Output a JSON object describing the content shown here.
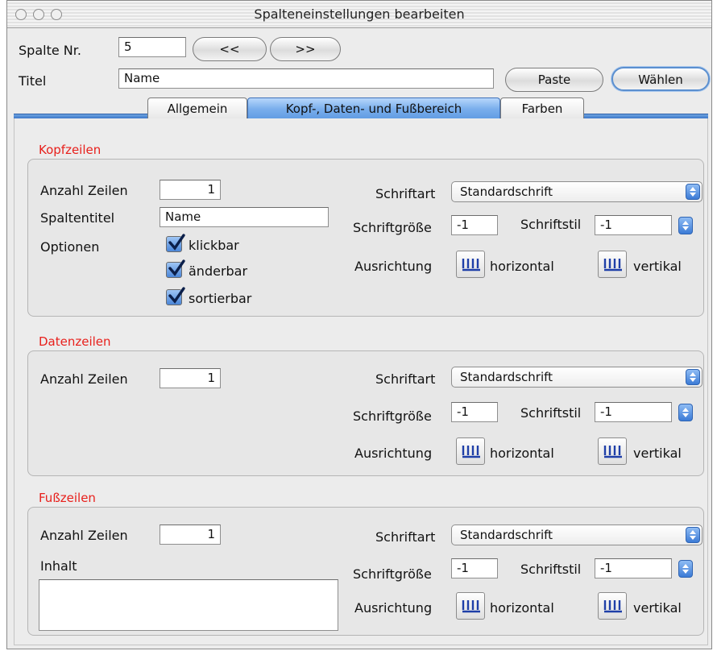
{
  "window": {
    "title": "Spalteneinstellungen bearbeiten"
  },
  "header": {
    "column_label": "Spalte Nr.",
    "column_value": "5",
    "prev_label": "<<",
    "next_label": ">>",
    "title_label": "Titel",
    "title_value": "Name",
    "paste_label": "Paste",
    "choose_label": "Wählen"
  },
  "tabs": [
    {
      "label": "Allgemein",
      "active": false
    },
    {
      "label": "Kopf-, Daten- und Fußbereich",
      "active": true
    },
    {
      "label": "Farben",
      "active": false
    }
  ],
  "kopf": {
    "title": "Kopfzeilen",
    "rows_label": "Anzahl Zeilen",
    "rows_value": "1",
    "coltitle_label": "Spaltentitel",
    "coltitle_value": "Name",
    "options_label": "Optionen",
    "options": [
      {
        "label": "klickbar",
        "checked": true
      },
      {
        "label": "änderbar",
        "checked": true
      },
      {
        "label": "sortierbar",
        "checked": true
      }
    ],
    "font_label": "Schriftart",
    "font_value": "Standardschrift",
    "size_label": "Schriftgröße",
    "size_value": "-1",
    "style_label": "Schriftstil",
    "style_value": "-1",
    "align_label": "Ausrichtung",
    "horizontal_label": "horizontal",
    "vertical_label": "vertikal"
  },
  "daten": {
    "title": "Datenzeilen",
    "rows_label": "Anzahl Zeilen",
    "rows_value": "1",
    "font_label": "Schriftart",
    "font_value": "Standardschrift",
    "size_label": "Schriftgröße",
    "size_value": "-1",
    "style_label": "Schriftstil",
    "style_value": "-1",
    "align_label": "Ausrichtung",
    "horizontal_label": "horizontal",
    "vertical_label": "vertikal"
  },
  "fuss": {
    "title": "Fußzeilen",
    "rows_label": "Anzahl Zeilen",
    "rows_value": "1",
    "content_label": "Inhalt",
    "content_value": "",
    "font_label": "Schriftart",
    "font_value": "Standardschrift",
    "size_label": "Schriftgröße",
    "size_value": "-1",
    "style_label": "Schriftstil",
    "style_value": "-1",
    "align_label": "Ausrichtung",
    "horizontal_label": "horizontal",
    "vertical_label": "vertikal"
  },
  "colors": {
    "accent": "#3d78c9",
    "section_title": "#e8201c"
  },
  "icons": {
    "window_buttons": "traffic-light-circles",
    "select_arrow": "up-down-arrows-icon",
    "align": "text-align-columns-icon",
    "checkbox": "checkmark-icon"
  }
}
